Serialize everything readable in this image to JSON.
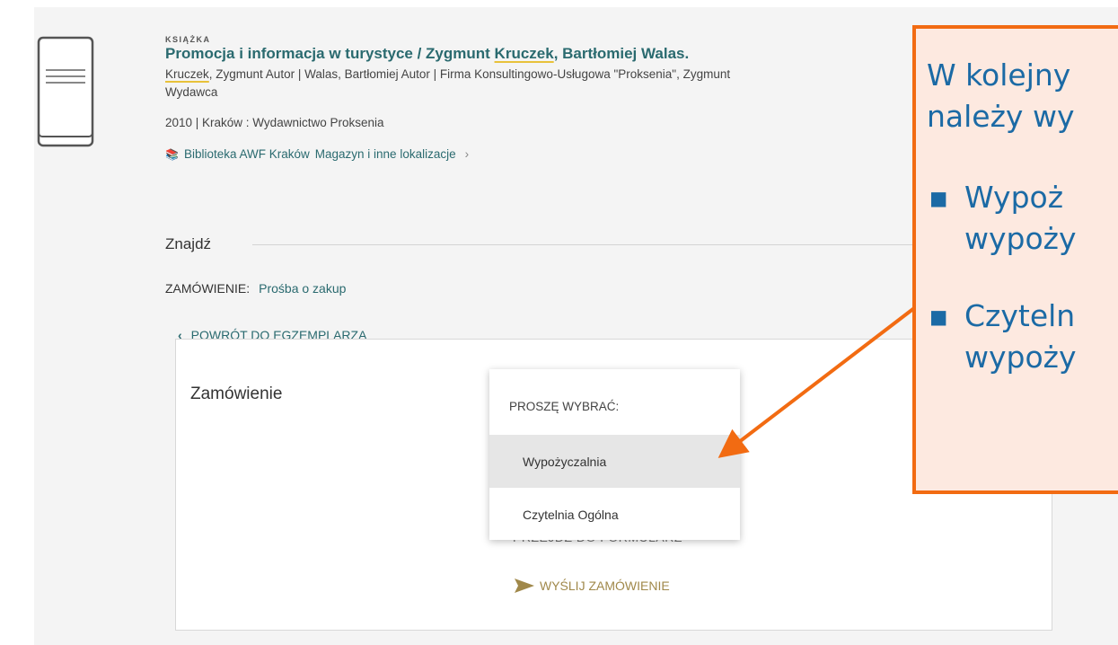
{
  "record": {
    "type_label": "KSIĄŻKA",
    "title_part1": "Promocja i informacja w turystyce / Zygmunt ",
    "title_highlight": "Kruczek",
    "title_part2": ", Bartłomiej Walas.",
    "authors_highlight": "Kruczek",
    "authors_rest": ", Zygmunt Autor | Walas, Bartłomiej Autor | Firma Konsultingowo-Usługowa \"Proksenia\", Zygmunt",
    "authors_line2": "Wydawca",
    "pub_info": "2010 | Kraków : Wydawnictwo Proksenia",
    "location_library": "Biblioteka AWF Kraków",
    "location_detail": "Magazyn i inne lokalizacje",
    "location_icon": "library-icon"
  },
  "find": {
    "heading": "Znajdź",
    "order_label": "ZAMÓWIENIE:",
    "order_value": "Prośba o zakup",
    "back_label": "POWRÓT DO EGZEMPLARZA"
  },
  "order_form": {
    "title": "Zamówienie",
    "hidden_label": "PRZEJDŹ DO FORMULARZ",
    "send_label": "WYŚLIJ ZAMÓWIENIE",
    "send_icon": "send-icon"
  },
  "dropdown": {
    "header": "PROSZĘ WYBRAĆ:",
    "options": [
      "Wypożyczalnia",
      "Czytelnia Ogólna"
    ],
    "selected_index": 0
  },
  "callout": {
    "line1": "W kolejny",
    "line2": "należy wy",
    "bullet": "▪",
    "item1_line1": "Wypoż",
    "item1_line2": "wypoży",
    "item2_line1": "Czyteln",
    "item2_line2": "wypoży"
  },
  "colors": {
    "link_teal": "#2a6a6f",
    "highlight_yellow": "#e8c23a",
    "callout_border": "#f26b12",
    "callout_bg": "#fde9e0",
    "callout_text": "#1b6aa5",
    "send_gold": "#a0884a"
  }
}
